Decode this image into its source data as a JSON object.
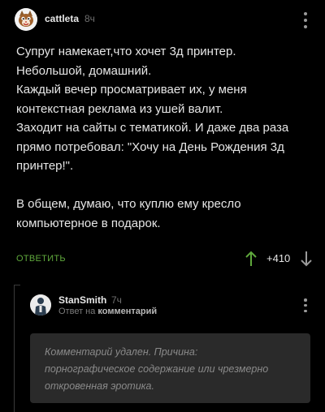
{
  "comment": {
    "author": "cattleta",
    "time": "8ч",
    "paragraphs": [
      "Супруг намекает,что хочет 3д принтер.\nНебольшой, домашний.\nКаждый вечер просматривает их, у меня контекстная реклама из ушей валит.\nЗаходит на сайты с тематикой. И даже два раза прямо потребовал: \"Хочу на День Рождения 3д принтер!\".",
      "В общем, думаю, что куплю ему кресло компьютерное в подарок."
    ],
    "reply_label": "ОТВЕТИТЬ",
    "rating": "+410"
  },
  "reply": {
    "author": "StanSmith",
    "time": "7ч",
    "reply_prefix": "Ответ на",
    "reply_target": "комментарий",
    "deleted_text": "Комментарий удален. Причина:\nпорнографическое содержание или чрезмерно откровенная эротика."
  },
  "colors": {
    "background": "#000000",
    "accent_green": "#5fa83c",
    "text": "#e6e6e6",
    "muted": "#6f6f6f",
    "deleted_box": "#2a2a2a"
  },
  "icons": {
    "menu": "kebab-menu-icon",
    "vote_up": "arrow-up-icon",
    "vote_down": "arrow-down-icon"
  }
}
